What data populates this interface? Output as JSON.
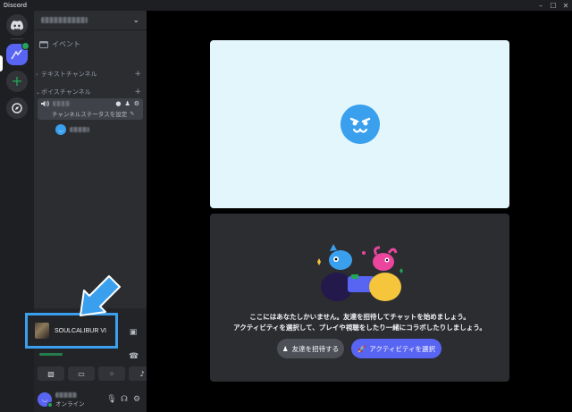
{
  "titlebar": {
    "app_name": "Discord",
    "minimize": "–",
    "maximize": "☐",
    "close": "✕"
  },
  "colors": {
    "accent": "#5865f2",
    "online": "#23a55a",
    "highlight": "#3aa0ee",
    "sidebar": "#2b2d31",
    "rail": "#1e1f22"
  },
  "sidebar": {
    "events_label": "イベント",
    "text_category": "テキストチャンネル",
    "voice_category": "ボイスチャンネル",
    "voice_channel_topic": "チャンネルステータスを設定"
  },
  "stream": {
    "game_name": "SOULCALIBUR VI"
  },
  "user": {
    "status": "オンライン"
  },
  "main": {
    "message_line1": "ここにはあなたしかいません。友達を招待してチャットを始めましょう。",
    "message_line2": "アクティビティを選択して、プレイや視聴をしたり一緒にコラボしたりしましょう。",
    "invite_button": "友達を招待する",
    "activity_button": "アクティビティを選択"
  }
}
